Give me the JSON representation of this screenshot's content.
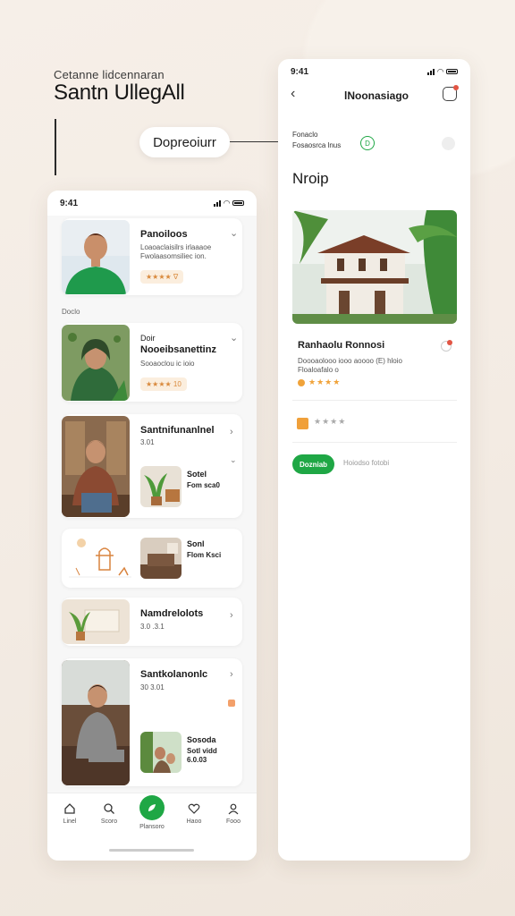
{
  "header": {
    "kicker": "Cetanne lidcennaran",
    "brand": "Santn UllegAll",
    "pill_label": "Dopreoiurr"
  },
  "left_phone": {
    "time": "9:41",
    "cards": [
      {
        "title": "Panoiloos",
        "sub": "Loaoaclaisilrs irlaaaoe\nFwolaasomsiliec ion.",
        "tag": "★★★★ ∇",
        "chev": "⌄"
      },
      {
        "pre": "Doir",
        "title": "Nooeibsanettinz",
        "sub": "Sooaoclou ic ioio",
        "tag": "★★★★ 10",
        "chev": "⌄"
      },
      {
        "title": "Santnifunanlnel",
        "sub": "3.01",
        "mini_title": "Sotel",
        "mini_sub": "Fom sca0",
        "chev": "›"
      },
      {
        "mini_title": "Sonl",
        "mini_sub": "Flom Ksci"
      },
      {
        "title": "Namdrelolots",
        "sub": "3.0 .3.1",
        "chev": "›"
      },
      {
        "title": "Santkolanonlc",
        "sub": "30 3.01",
        "mini_title": "Sosoda",
        "mini_sub": "Sotl vidd\n6.0.03",
        "chev": "›"
      }
    ],
    "section_label": "Doclo",
    "nav": [
      {
        "label": "Linel",
        "icon": "home-icon"
      },
      {
        "label": "Scoro",
        "icon": "search-icon"
      },
      {
        "label": "Plansoro",
        "icon": "leaf-icon"
      },
      {
        "label": "Haoo",
        "icon": "heart-icon"
      },
      {
        "label": "Fooo",
        "icon": "profile-icon"
      }
    ]
  },
  "right_phone": {
    "time": "9:41",
    "title": "lNoonasiago",
    "small_line1": "Fonaclo",
    "small_line2": "Fosaosrca lnus",
    "green_icon_label": "D",
    "big_word": "Nroip",
    "card_title": "Ranhaolu Ronnosi",
    "card_sub": "Doooaolooo iooo aoooo  (E) hloio\nFloaloafalo o",
    "card_stars": "★★★★",
    "row_stars": "★★★★",
    "button_label": "Dozniab",
    "button_aside": "Hoiodso fotobi"
  },
  "colors": {
    "accent_green": "#1fa745",
    "star_orange": "#f0a33a",
    "notification_red": "#e25544"
  }
}
